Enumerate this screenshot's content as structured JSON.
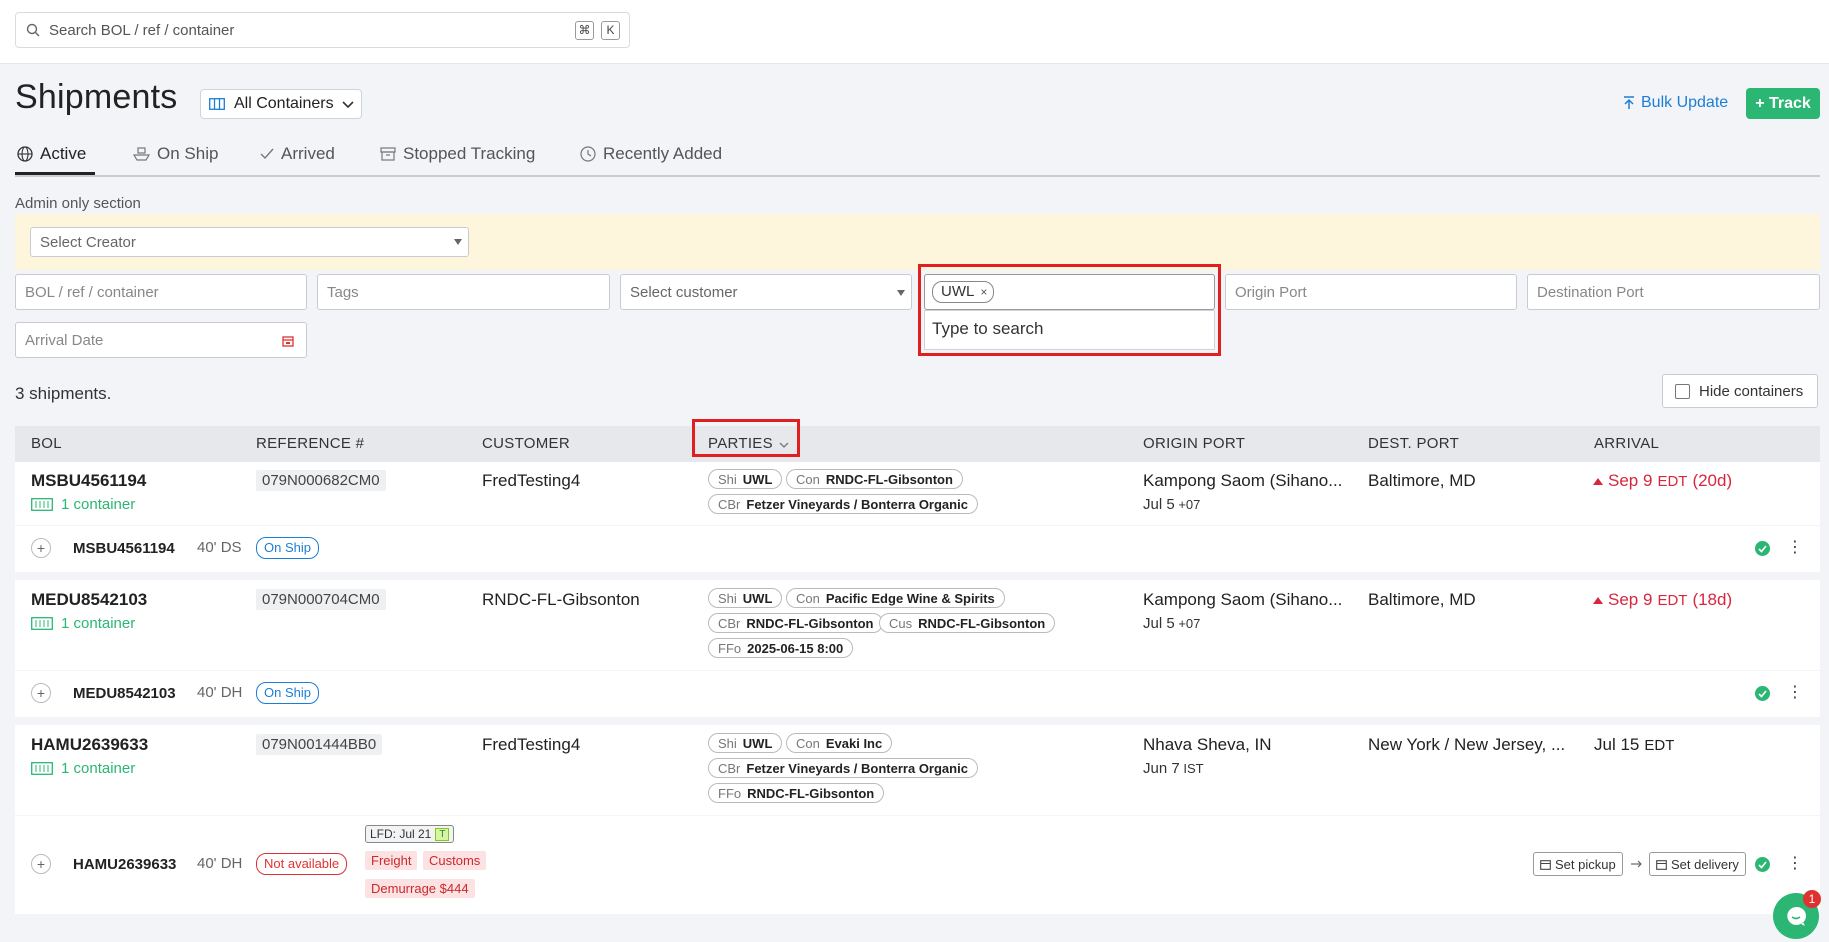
{
  "search": {
    "placeholder": "Search BOL / ref / container",
    "kbd1": "⌘",
    "kbd2": "K"
  },
  "header": {
    "title": "Shipments",
    "view_selector": "All Containers",
    "bulk_update": "Bulk Update",
    "track": "+ Track"
  },
  "tabs": [
    {
      "label": "Active",
      "icon": "globe-icon"
    },
    {
      "label": "On Ship",
      "icon": "ship-icon"
    },
    {
      "label": "Arrived",
      "icon": "check-icon"
    },
    {
      "label": "Stopped Tracking",
      "icon": "archive-icon"
    },
    {
      "label": "Recently Added",
      "icon": "clock-icon"
    }
  ],
  "admin": {
    "label": "Admin only section",
    "creator_placeholder": "Select Creator"
  },
  "filters": {
    "bol": "BOL / ref / container",
    "tags": "Tags",
    "customer": "Select customer",
    "party_chip": "UWL",
    "party_hint": "Type to search",
    "origin": "Origin Port",
    "destination": "Destination Port",
    "arrival": "Arrival Date"
  },
  "summary": {
    "count": "3 shipments.",
    "hide_containers": "Hide containers"
  },
  "columns": {
    "bol": "BOL",
    "ref": "REFERENCE #",
    "customer": "CUSTOMER",
    "parties": "PARTIES",
    "origin": "ORIGIN PORT",
    "dest": "DEST. PORT",
    "arrival": "ARRIVAL"
  },
  "colors": {
    "accent_green": "#2bb673",
    "accent_blue": "#1c7ed6",
    "alert_red": "#d7263d",
    "highlight_red": "#e02020"
  },
  "shipments": [
    {
      "bol": "MSBU4561194",
      "containers": "1 container",
      "ref": "079N000682CM0",
      "customer": "FredTesting4",
      "parties": [
        {
          "k": "Shi",
          "v": "UWL"
        },
        {
          "k": "Con",
          "v": "RNDC-FL-Gibsonton"
        },
        {
          "k": "CBr",
          "v": "Fetzer Vineyards / Bonterra Organic"
        }
      ],
      "origin": "Kampong Saom (Sihano...",
      "origin_date": "Jul 5",
      "origin_tz": "+07",
      "dest": "Baltimore, MD",
      "arrival": "Sep 9",
      "arrival_tz": "EDT",
      "arrival_delta": "(20d)",
      "container": {
        "id": "MSBU4561194",
        "size": "40' DS",
        "status": "On Ship"
      }
    },
    {
      "bol": "MEDU8542103",
      "containers": "1 container",
      "ref": "079N000704CM0",
      "customer": "RNDC-FL-Gibsonton",
      "parties": [
        {
          "k": "Shi",
          "v": "UWL"
        },
        {
          "k": "Con",
          "v": "Pacific Edge Wine & Spirits"
        },
        {
          "k": "CBr",
          "v": "RNDC-FL-Gibsonton"
        },
        {
          "k": "Cus",
          "v": "RNDC-FL-Gibsonton"
        },
        {
          "k": "FFo",
          "v": "2025-06-15 8:00"
        }
      ],
      "origin": "Kampong Saom (Sihano...",
      "origin_date": "Jul 5",
      "origin_tz": "+07",
      "dest": "Baltimore, MD",
      "arrival": "Sep 9",
      "arrival_tz": "EDT",
      "arrival_delta": "(18d)",
      "container": {
        "id": "MEDU8542103",
        "size": "40' DH",
        "status": "On Ship"
      }
    },
    {
      "bol": "HAMU2639633",
      "containers": "1 container",
      "ref": "079N001444BB0",
      "customer": "FredTesting4",
      "parties": [
        {
          "k": "Shi",
          "v": "UWL"
        },
        {
          "k": "Con",
          "v": "Evaki Inc"
        },
        {
          "k": "CBr",
          "v": "Fetzer Vineyards / Bonterra Organic"
        },
        {
          "k": "FFo",
          "v": "RNDC-FL-Gibsonton"
        }
      ],
      "origin": "Nhava Sheva, IN",
      "origin_date": "Jun 7",
      "origin_tz": "IST",
      "dest": "New York / New Jersey, ...",
      "arrival": "Jul 15",
      "arrival_tz": "EDT",
      "container": {
        "id": "HAMU2639633",
        "size": "40' DH",
        "status": "Not available",
        "lfd": "LFD: Jul 21",
        "lfd_badge": "T",
        "holds": [
          "Freight",
          "Customs"
        ],
        "demurrage": "Demurrage $444",
        "set_pickup": "Set pickup",
        "set_delivery": "Set delivery"
      }
    }
  ],
  "chat": {
    "notifications": "1"
  }
}
